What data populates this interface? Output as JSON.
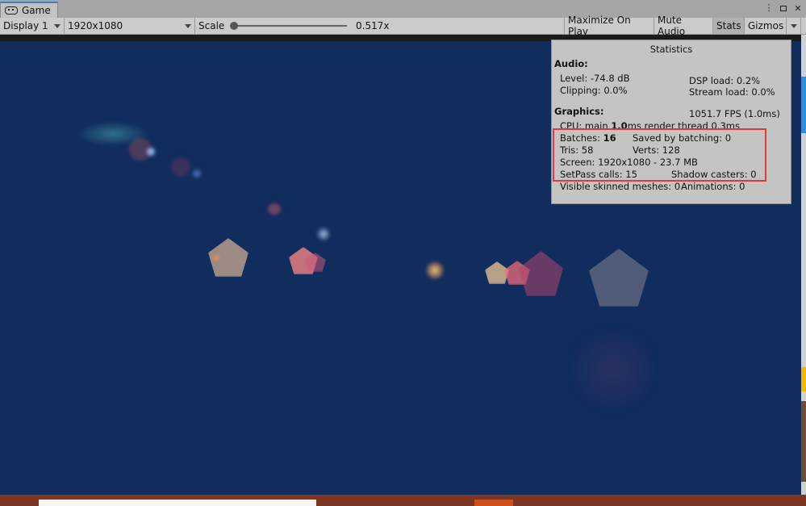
{
  "tab": {
    "label": "Game"
  },
  "toolbar": {
    "display": "Display 1",
    "resolution": "1920x1080",
    "scale_label": "Scale",
    "scale_value": "0.517x",
    "maximize_on_play": "Maximize On Play",
    "mute_audio": "Mute Audio",
    "stats": "Stats",
    "gizmos": "Gizmos"
  },
  "stats": {
    "title": "Statistics",
    "audio_header": "Audio:",
    "level": "Level: -74.8 dB",
    "clipping": "Clipping: 0.0%",
    "dsp_load": "DSP load: 0.2%",
    "stream_load": "Stream load: 0.0%",
    "graphics_header": "Graphics:",
    "fps": "1051.7 FPS (1.0ms)",
    "cpu_prefix": "CPU: main ",
    "cpu_main": "1.0",
    "cpu_suffix": "ms  render thread 0.3ms",
    "batches_label": "Batches: ",
    "batches_value": "16",
    "saved_by_batching": "Saved by batching: 0",
    "tris": "Tris: 58",
    "verts": "Verts: 128",
    "screen": "Screen: 1920x1080 - 23.7 MB",
    "setpass": "SetPass calls: 15",
    "shadow_casters": "Shadow casters: 0",
    "visible_skinned": "Visible skinned meshes: 0",
    "animations": "Animations: 0"
  },
  "colors": {
    "game_background": "#112d5e",
    "highlight": "#e03a3a",
    "tab_accent": "#3a7bd5"
  }
}
